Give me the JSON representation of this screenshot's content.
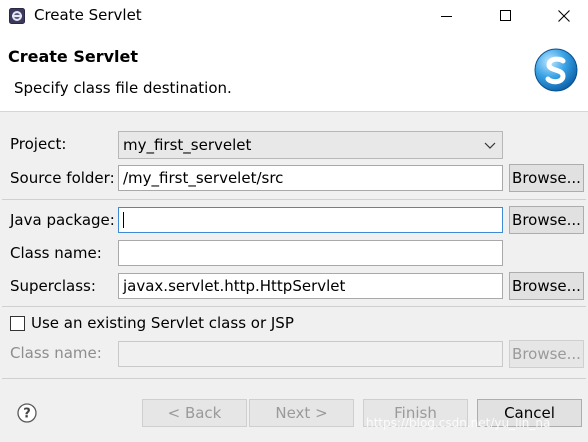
{
  "window": {
    "title": "Create Servlet",
    "app_icon": "eclipse-icon",
    "controls": [
      "minimize-icon",
      "maximize-icon",
      "close-icon"
    ]
  },
  "header": {
    "title": "Create Servlet",
    "description": "Specify class file destination.",
    "logo": "servlet-s-logo-icon"
  },
  "form": {
    "project": {
      "label": "Project:",
      "value": "my_first_servelet"
    },
    "source_folder": {
      "label": "Source folder:",
      "value": "/my_first_servelet/src",
      "browse": "Browse..."
    },
    "java_package": {
      "label": "Java package:",
      "value": "",
      "browse": "Browse..."
    },
    "class_name": {
      "label": "Class name:",
      "value": ""
    },
    "superclass": {
      "label": "Superclass:",
      "value": "javax.servlet.http.HttpServlet",
      "browse": "Browse..."
    },
    "existing": {
      "checkbox_label": "Use an existing Servlet class or JSP",
      "checked": false,
      "class_label": "Class name:",
      "class_value": "",
      "browse": "Browse..."
    }
  },
  "footer": {
    "help_icon": "help-icon",
    "back": "< Back",
    "next": "Next >",
    "finish": "Finish",
    "cancel": "Cancel",
    "watermark": "https://blog.csdn.net/yu_lin_na"
  }
}
